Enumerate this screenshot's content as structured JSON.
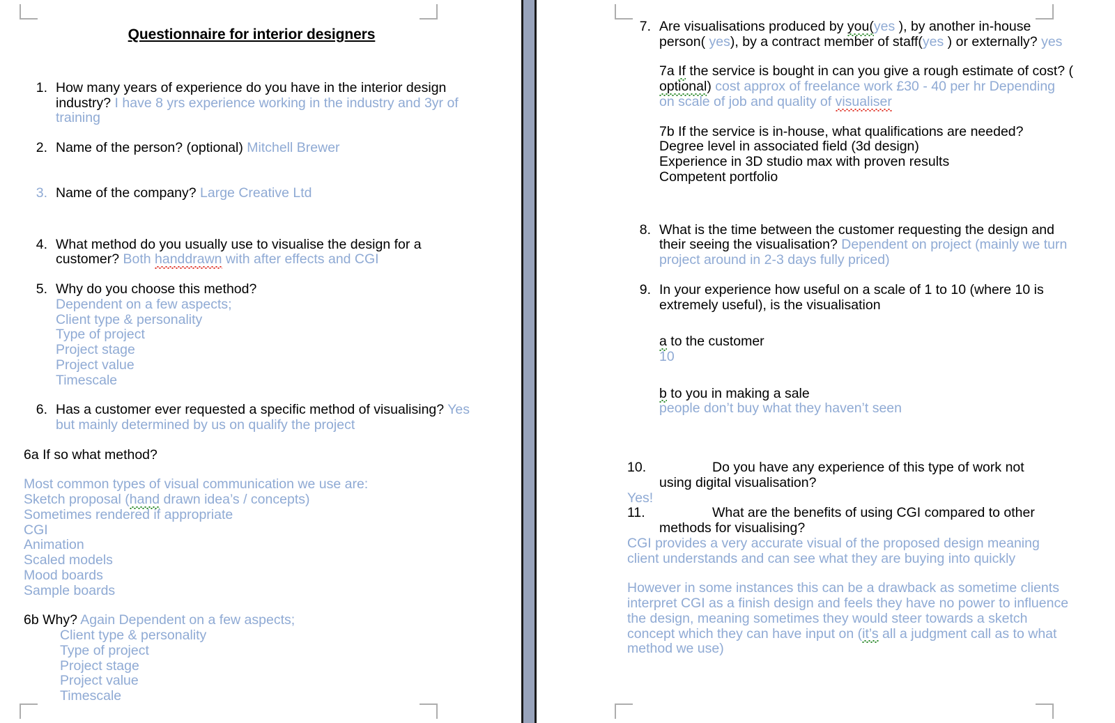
{
  "document": {
    "title": "Questionnaire for interior designers",
    "answer_color": "#8faad4",
    "question_color": "#000000",
    "gutter_color": "#98a3bb"
  },
  "left_page": {
    "q1": {
      "num": "1.",
      "question": "How many years of experience do you have in the interior design industry?",
      "answer": "I have 8 yrs experience working in the industry and 3yr of training"
    },
    "q2": {
      "num": "2.",
      "question": "Name of the person? (optional)",
      "answer": "Mitchell Brewer"
    },
    "q3": {
      "num": "3.",
      "question": "Name of the company?",
      "answer": "Large Creative Ltd"
    },
    "q4": {
      "num": "4.",
      "question": "What method do you usually use to visualise the design for a customer?",
      "answer_pre": "Both ",
      "answer_misspelled": "handdrawn",
      "answer_post": " with after effects and CGI"
    },
    "q5": {
      "num": "5.",
      "question": "Why do you choose this method?",
      "answers": [
        "Dependent on a few aspects;",
        "Client type & personality",
        "Type of project",
        "Project stage",
        "Project value",
        "Timescale"
      ]
    },
    "q6": {
      "num": "6.",
      "question": "Has a customer ever requested a specific method of visualising?",
      "answer": "Yes but mainly determined by us on qualify the project"
    },
    "q6a": {
      "label": "6a If so what method?",
      "answer_lines": [
        "Most common types of visual communication we use are:",
        "Sometimes rendered if appropriate",
        "CGI",
        "Animation",
        "Scaled models",
        "Mood boards",
        "Sample boards"
      ],
      "sketch_line_pre": "Sketch proposal (",
      "sketch_line_grammar": " hand",
      "sketch_line_post": " drawn idea’s / concepts)"
    },
    "q6b": {
      "label": "6b Why?",
      "answer_first": "Again Dependent on a few aspects;",
      "answers": [
        "Client type & personality",
        "Type of project",
        "Project stage",
        "Project value",
        "Timescale"
      ]
    }
  },
  "right_page": {
    "q7": {
      "num": "7.",
      "q_a": "Are visualisations produced by ",
      "q_you": "you(",
      "ans1": "yes",
      "q_b": " ), by another in-house person( ",
      "ans2": "yes",
      "q_c": "), by a contract member of staff(",
      "ans3": "yes",
      "q_d": " ) or externally? ",
      "ans4": "yes"
    },
    "q7a": {
      "pre": "7a ",
      "grammar_word": "If",
      "mid": " the service is bought in can you give a rough estimate of cost? (",
      "optional_word": "optional",
      "mid2": ") ",
      "answer_pre": "cost approx of freelance work £30 - 40 per hr Depending on scale of job and quality of ",
      "answer_misspelled": "visualiser"
    },
    "q7b": {
      "label": "7b If the service is in-house, what qualifications are needed?",
      "lines": [
        "Degree level in associated field (3d design)",
        "Experience in 3D studio max with proven results",
        "Competent portfolio"
      ]
    },
    "q8": {
      "num": "8.",
      "question": "What is the time between the customer requesting the design and their seeing the visualisation?",
      "answer": "Dependent on project (mainly we turn project around in 2-3 days fully priced)"
    },
    "q9": {
      "num": "9.",
      "question": "In your experience how useful on a scale of 1 to 10 (where 10 is extremely useful), is the visualisation",
      "part_a_letter": "a",
      "part_a_label": " to the customer",
      "part_a_answer": "10",
      "part_b_letter": "b",
      "part_b_label": " to you in making a sale",
      "part_b_answer": "people don’t buy what they haven’t seen"
    },
    "q10": {
      "num": "10.",
      "question": "Do you have any experience of this type of work not",
      "question_cont": "using digital visualisation?",
      "answer": "Yes!"
    },
    "q11": {
      "num": "11.",
      "question": "What are the benefits of using CGI compared to other",
      "question_cont": "methods for visualising?",
      "answer": "CGI provides a very accurate visual of the proposed design meaning client understands and can see what they are buying into quickly",
      "answer2_pre": "However in some instances this can be a drawback as sometime clients interpret CGI as a finish design and feels they have no power to influence the design, meaning sometimes they would steer towards a sketch concept which they can have input on (",
      "answer2_grammar": "it’s",
      "answer2_post": " all a judgment call as to what method we use)"
    }
  }
}
